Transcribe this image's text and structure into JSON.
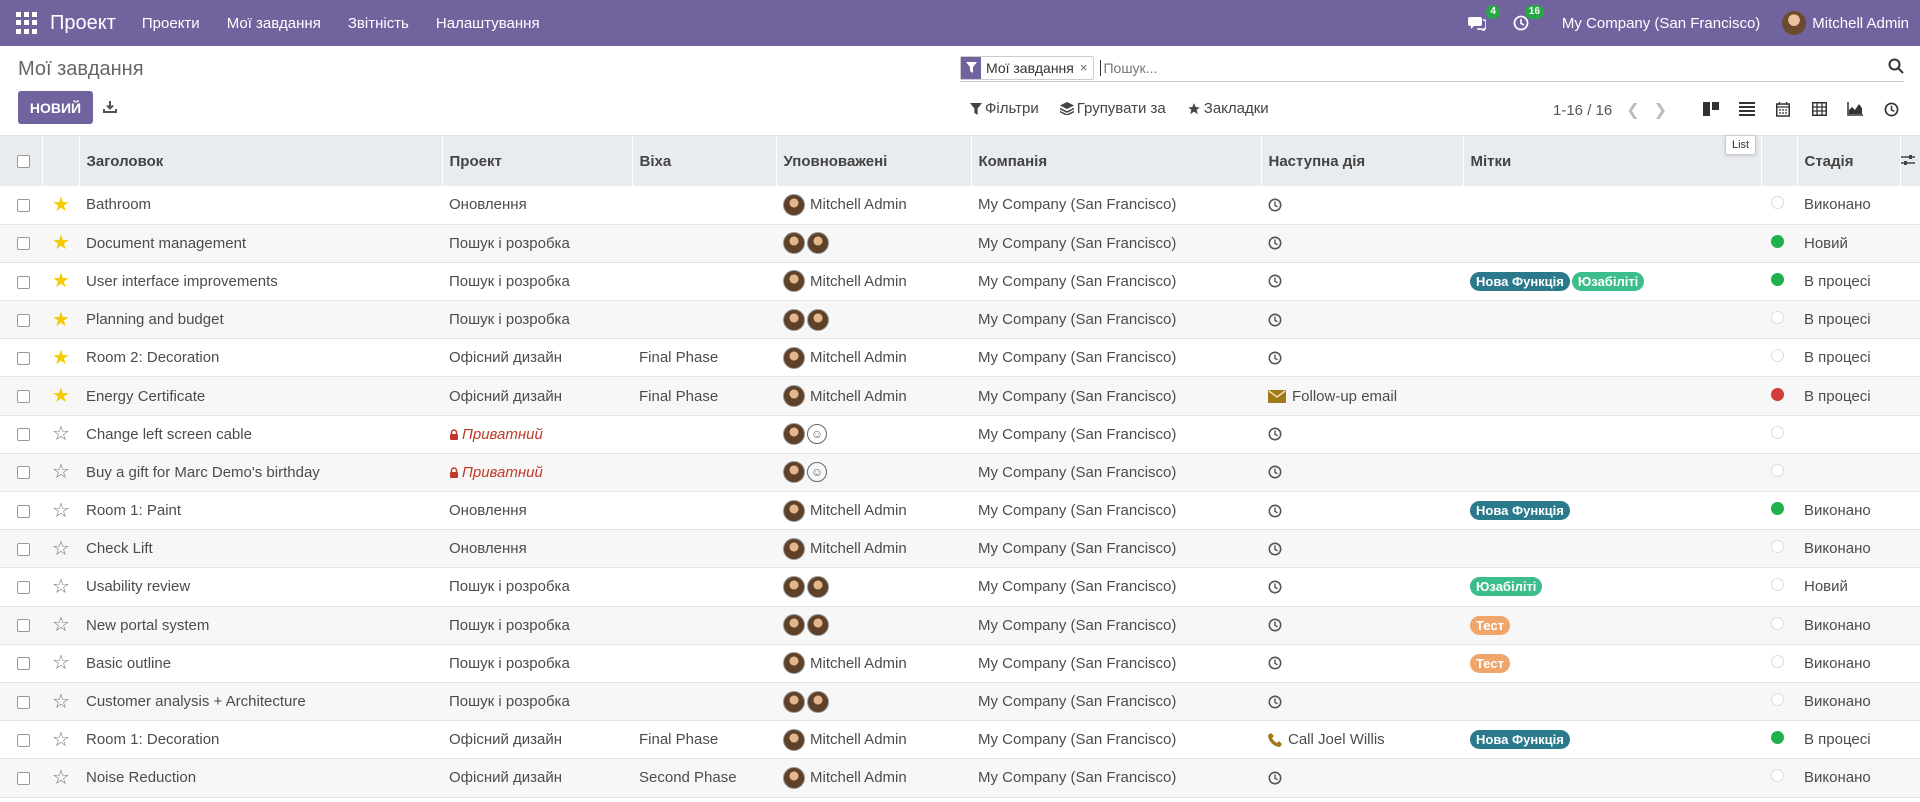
{
  "navbar": {
    "brand": "Проект",
    "menu": [
      "Проекти",
      "Мої завдання",
      "Звітність",
      "Налаштування"
    ],
    "messages_count": "4",
    "activities_count": "16",
    "company": "My Company (San Francisco)",
    "user": "Mitchell Admin"
  },
  "control": {
    "title": "Мої завдання",
    "new_label": "НОВИЙ",
    "facet": "Мої завдання",
    "facet_remove": "×",
    "search_placeholder": "Пошук...",
    "filters_label": "Фільтри",
    "group_label": "Групувати за",
    "favorites_label": "Закладки",
    "pager": "1-16 / 16",
    "tooltip": "List"
  },
  "columns": [
    "Заголовок",
    "Проект",
    "Віха",
    "Уповноважені",
    "Компанія",
    "Наступна дія",
    "Мітки",
    "Стадія"
  ],
  "colors": {
    "brand": "#71639e",
    "tag_new_feature": "#2a7a8c",
    "tag_usability": "#3bbd8c",
    "tag_test": "#f0a56b",
    "star": "#f3cc00",
    "kanban_green": "#21b14c",
    "kanban_red": "#d23f3a"
  },
  "rows": [
    {
      "title": "Bathroom",
      "star": true,
      "project": "Оновлення",
      "private": false,
      "milestone": "",
      "assignees": [
        "img"
      ],
      "assignee_name": "Mitchell Admin",
      "company": "My Company (San Francisco)",
      "activity_icon": "clock",
      "activity": "",
      "tags": [],
      "kanban": "grey",
      "stage": "Виконано"
    },
    {
      "title": "Document management",
      "star": true,
      "project": "Пошук і розробка",
      "private": false,
      "milestone": "",
      "assignees": [
        "img",
        "img"
      ],
      "assignee_name": "",
      "company": "My Company (San Francisco)",
      "activity_icon": "clock",
      "activity": "",
      "tags": [],
      "kanban": "green",
      "stage": "Новий"
    },
    {
      "title": "User interface improvements",
      "star": true,
      "project": "Пошук і розробка",
      "private": false,
      "milestone": "",
      "assignees": [
        "img"
      ],
      "assignee_name": "Mitchell Admin",
      "company": "My Company (San Francisco)",
      "activity_icon": "clock",
      "activity": "",
      "tags": [
        {
          "label": "Нова Функція",
          "color": "#2a7a8c"
        },
        {
          "label": "Юзабіліті",
          "color": "#3bbd8c"
        }
      ],
      "kanban": "green",
      "stage": "В процесі"
    },
    {
      "title": "Planning and budget",
      "star": true,
      "project": "Пошук і розробка",
      "private": false,
      "milestone": "",
      "assignees": [
        "img",
        "img"
      ],
      "assignee_name": "",
      "company": "My Company (San Francisco)",
      "activity_icon": "clock",
      "activity": "",
      "tags": [],
      "kanban": "grey",
      "stage": "В процесі"
    },
    {
      "title": "Room 2: Decoration",
      "star": true,
      "project": "Офісний дизайн",
      "private": false,
      "milestone": "Final Phase",
      "assignees": [
        "img"
      ],
      "assignee_name": "Mitchell Admin",
      "company": "My Company (San Francisco)",
      "activity_icon": "clock",
      "activity": "",
      "tags": [],
      "kanban": "grey",
      "stage": "В процесі"
    },
    {
      "title": "Energy Certificate",
      "star": true,
      "project": "Офісний дизайн",
      "private": false,
      "milestone": "Final Phase",
      "assignees": [
        "img"
      ],
      "assignee_name": "Mitchell Admin",
      "company": "My Company (San Francisco)",
      "activity_icon": "email",
      "activity": "Follow-up email",
      "tags": [],
      "kanban": "red",
      "stage": "В процесі"
    },
    {
      "title": "Change left screen cable",
      "star": false,
      "project": "Приватний",
      "private": true,
      "milestone": "",
      "assignees": [
        "img",
        "empty"
      ],
      "assignee_name": "",
      "company": "My Company (San Francisco)",
      "activity_icon": "clock",
      "activity": "",
      "tags": [],
      "kanban": "grey",
      "stage": ""
    },
    {
      "title": "Buy a gift for Marc Demo's birthday",
      "star": false,
      "project": "Приватний",
      "private": true,
      "milestone": "",
      "assignees": [
        "img",
        "empty"
      ],
      "assignee_name": "",
      "company": "My Company (San Francisco)",
      "activity_icon": "clock",
      "activity": "",
      "tags": [],
      "kanban": "grey",
      "stage": ""
    },
    {
      "title": "Room 1: Paint",
      "star": false,
      "project": "Оновлення",
      "private": false,
      "milestone": "",
      "assignees": [
        "img"
      ],
      "assignee_name": "Mitchell Admin",
      "company": "My Company (San Francisco)",
      "activity_icon": "clock",
      "activity": "",
      "tags": [
        {
          "label": "Нова Функція",
          "color": "#2a7a8c"
        }
      ],
      "kanban": "green",
      "stage": "Виконано"
    },
    {
      "title": "Check Lift",
      "star": false,
      "project": "Оновлення",
      "private": false,
      "milestone": "",
      "assignees": [
        "img"
      ],
      "assignee_name": "Mitchell Admin",
      "company": "My Company (San Francisco)",
      "activity_icon": "clock",
      "activity": "",
      "tags": [],
      "kanban": "grey",
      "stage": "Виконано"
    },
    {
      "title": "Usability review",
      "star": false,
      "project": "Пошук і розробка",
      "private": false,
      "milestone": "",
      "assignees": [
        "img",
        "img"
      ],
      "assignee_name": "",
      "company": "My Company (San Francisco)",
      "activity_icon": "clock",
      "activity": "",
      "tags": [
        {
          "label": "Юзабіліті",
          "color": "#3bbd8c"
        }
      ],
      "kanban": "grey",
      "stage": "Новий"
    },
    {
      "title": "New portal system",
      "star": false,
      "project": "Пошук і розробка",
      "private": false,
      "milestone": "",
      "assignees": [
        "img",
        "img"
      ],
      "assignee_name": "",
      "company": "My Company (San Francisco)",
      "activity_icon": "clock",
      "activity": "",
      "tags": [
        {
          "label": "Тест",
          "color": "#f0a56b"
        }
      ],
      "kanban": "grey",
      "stage": "Виконано"
    },
    {
      "title": "Basic outline",
      "star": false,
      "project": "Пошук і розробка",
      "private": false,
      "milestone": "",
      "assignees": [
        "img"
      ],
      "assignee_name": "Mitchell Admin",
      "company": "My Company (San Francisco)",
      "activity_icon": "clock",
      "activity": "",
      "tags": [
        {
          "label": "Тест",
          "color": "#f0a56b"
        }
      ],
      "kanban": "grey",
      "stage": "Виконано"
    },
    {
      "title": "Customer analysis + Architecture",
      "star": false,
      "project": "Пошук і розробка",
      "private": false,
      "milestone": "",
      "assignees": [
        "img",
        "img"
      ],
      "assignee_name": "",
      "company": "My Company (San Francisco)",
      "activity_icon": "clock",
      "activity": "",
      "tags": [],
      "kanban": "grey",
      "stage": "Виконано"
    },
    {
      "title": "Room 1: Decoration",
      "star": false,
      "project": "Офісний дизайн",
      "private": false,
      "milestone": "Final Phase",
      "assignees": [
        "img"
      ],
      "assignee_name": "Mitchell Admin",
      "company": "My Company (San Francisco)",
      "activity_icon": "phone",
      "activity": "Call Joel Willis",
      "tags": [
        {
          "label": "Нова Функція",
          "color": "#2a7a8c"
        }
      ],
      "kanban": "green",
      "stage": "В процесі"
    },
    {
      "title": "Noise Reduction",
      "star": false,
      "project": "Офісний дизайн",
      "private": false,
      "milestone": "Second Phase",
      "assignees": [
        "img"
      ],
      "assignee_name": "Mitchell Admin",
      "company": "My Company (San Francisco)",
      "activity_icon": "clock",
      "activity": "",
      "tags": [],
      "kanban": "grey",
      "stage": "Виконано"
    }
  ]
}
